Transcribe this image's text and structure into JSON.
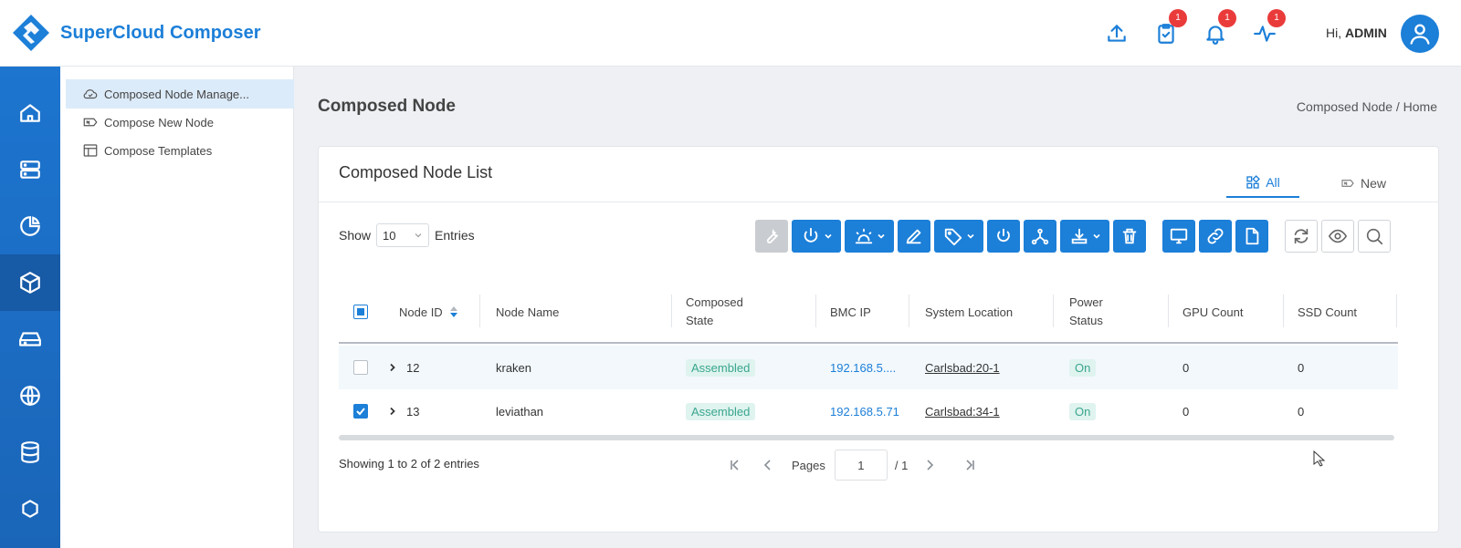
{
  "app": {
    "title": "SuperCloud Composer"
  },
  "header": {
    "greeting_prefix": "Hi, ",
    "user": "ADMIN",
    "badges": {
      "tasks": "1",
      "notifications": "1",
      "activity": "1"
    }
  },
  "rail": {
    "icons": [
      "home-icon",
      "server-icon",
      "pie-chart-icon",
      "cube-icon",
      "storage-icon",
      "globe-icon",
      "database-icon",
      "hexagon-icon"
    ]
  },
  "submenu": {
    "items": [
      {
        "label": "Composed Node Manage...",
        "active": true
      },
      {
        "label": "Compose New Node",
        "active": false
      },
      {
        "label": "Compose Templates",
        "active": false
      }
    ]
  },
  "page": {
    "title": "Composed Node",
    "breadcrumb": "Composed Node / Home"
  },
  "card": {
    "title": "Composed Node List",
    "tabs": [
      {
        "label": "All",
        "active": true
      },
      {
        "label": "New",
        "active": false
      }
    ],
    "show_label": "Show",
    "entries_value": "10",
    "entries_label": "Entries"
  },
  "table": {
    "columns": [
      "Node ID",
      "Node Name",
      "Composed State",
      "BMC IP",
      "System Location",
      "Power Status",
      "GPU Count",
      "SSD Count"
    ],
    "rows": [
      {
        "checked": false,
        "id": "12",
        "name": "kraken",
        "state": "Assembled",
        "bmc_ip": "192.168.5....",
        "location": "Carlsbad:20-1",
        "power": "On",
        "gpu": "0",
        "ssd": "0"
      },
      {
        "checked": true,
        "id": "13",
        "name": "leviathan",
        "state": "Assembled",
        "bmc_ip": "192.168.5.71",
        "location": "Carlsbad:34-1",
        "power": "On",
        "gpu": "0",
        "ssd": "0"
      }
    ]
  },
  "footer": {
    "showing": "Showing 1 to 2 of 2 entries",
    "pages_label": "Pages",
    "page": "1",
    "total": "/ 1"
  },
  "colors": {
    "primary": "#1c7fd8",
    "badge": "#ea3b3b",
    "assembled_bg": "#dff3ef",
    "assembled_fg": "#3aa68e"
  }
}
